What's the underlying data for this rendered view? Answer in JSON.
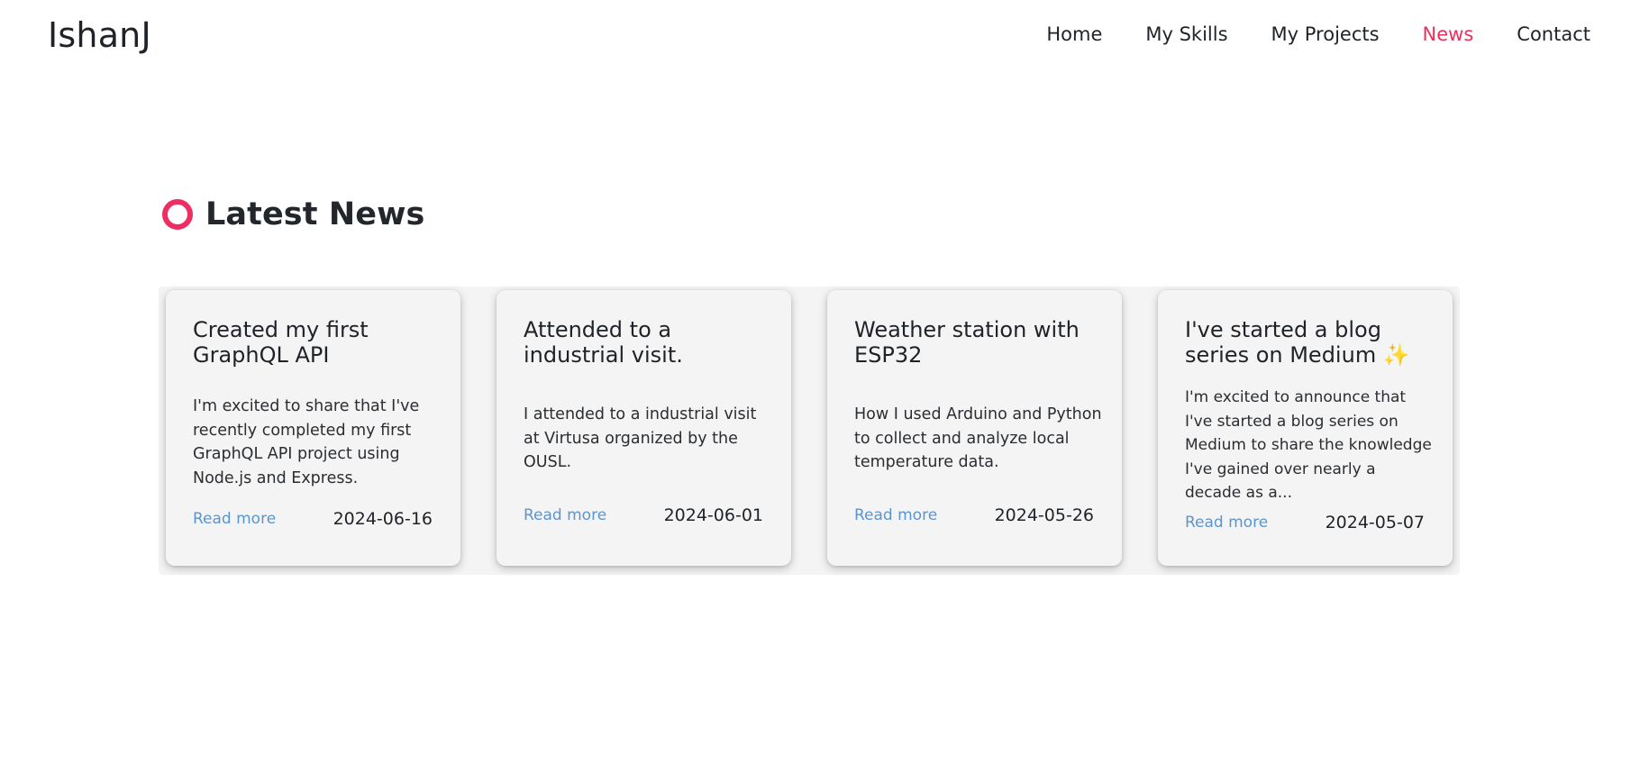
{
  "brand": "IshanJ",
  "nav": {
    "items": [
      {
        "label": "Home",
        "active": false
      },
      {
        "label": "My Skills",
        "active": false
      },
      {
        "label": "My Projects",
        "active": false
      },
      {
        "label": "News",
        "active": true
      },
      {
        "label": "Contact",
        "active": false
      }
    ]
  },
  "section": {
    "title": "Latest News",
    "icon": "ring-icon",
    "accent_color": "#ee2e62"
  },
  "cards": [
    {
      "title": "Created my first GraphQL API",
      "body": "I'm excited to share that I've recently completed my first GraphQL API project using Node.js and Express.",
      "link": "Read more",
      "date": "2024-06-16"
    },
    {
      "title": "Attended to a industrial visit.",
      "body": "I attended to a industrial visit at Virtusa organized by the OUSL.",
      "link": "Read more",
      "date": "2024-06-01"
    },
    {
      "title": "Weather station with ESP32",
      "body": "How I used Arduino and Python to collect and analyze local temperature data.",
      "link": "Read more",
      "date": "2024-05-26"
    },
    {
      "title": "I've started a blog series on Medium",
      "title_emoji": "✨",
      "body": "I'm excited to announce that I've started a blog series on Medium to share the knowledge I've gained over nearly a decade as a...",
      "link": "Read more",
      "date": "2024-05-07"
    }
  ],
  "colors": {
    "active_nav": "#e8315f",
    "link": "#5b95cf",
    "card_bg": "#f4f4f4"
  }
}
